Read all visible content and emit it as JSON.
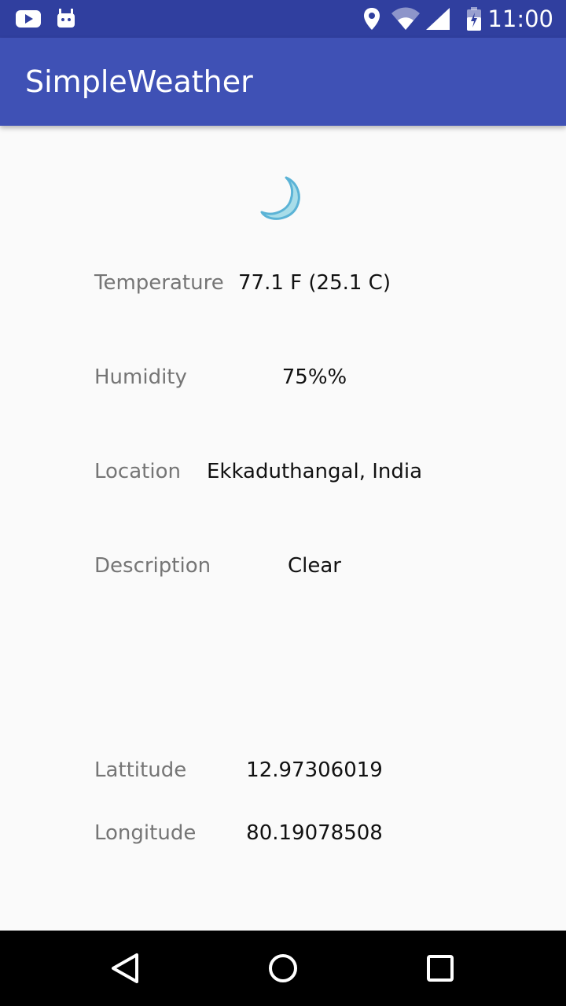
{
  "status_bar": {
    "time": "11:00",
    "left_icons": [
      "youtube-icon",
      "android-notification-icon"
    ],
    "right_icons": [
      "location-pin-icon",
      "wifi-icon",
      "cell-signal-icon",
      "battery-icon"
    ],
    "background": "#303f9f"
  },
  "app_bar": {
    "title": "SimpleWeather",
    "background": "#3f51b5"
  },
  "weather": {
    "icon": "crescent-moon-icon",
    "rows": [
      {
        "label": "Temperature",
        "value": "77.1 F (25.1 C)"
      },
      {
        "label": "Humidity",
        "value": "75%%"
      },
      {
        "label": "Location",
        "value": "Ekkaduthangal, India"
      },
      {
        "label": "Description",
        "value": "Clear"
      },
      {
        "label": "Lattitude",
        "value": "12.97306019"
      },
      {
        "label": "Longitude",
        "value": "80.19078508"
      }
    ]
  },
  "nav_bar": {
    "buttons": [
      "back-icon",
      "home-icon",
      "recents-icon"
    ]
  }
}
